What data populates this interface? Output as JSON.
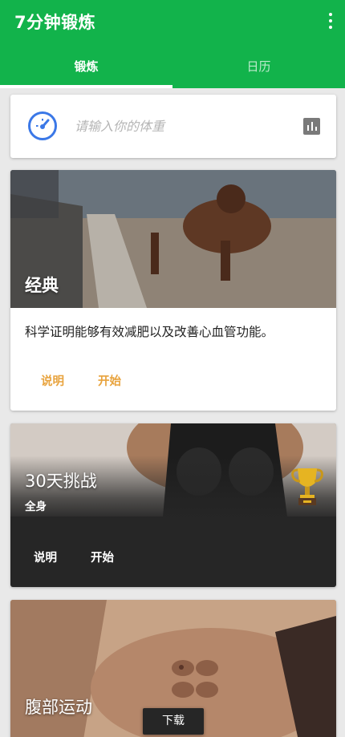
{
  "app": {
    "title": "7分钟锻炼"
  },
  "tabs": [
    {
      "label": "锻炼",
      "active": true
    },
    {
      "label": "日历",
      "active": false
    }
  ],
  "weight": {
    "placeholder": "请输入你的体重"
  },
  "cards": [
    {
      "title": "经典",
      "description": "科学证明能够有效减肥以及改善心血管功能。",
      "info_label": "说明",
      "start_label": "开始"
    },
    {
      "title": "30天挑战",
      "subtitle": "全身",
      "info_label": "说明",
      "start_label": "开始"
    },
    {
      "title": "腹部运动"
    }
  ],
  "download_label": "下载",
  "colors": {
    "appbar": "#12b34b",
    "accent": "#e8a33d",
    "dark_card": "#262626"
  },
  "icons": [
    "more-vert-icon",
    "gauge-icon",
    "bar-chart-icon",
    "trophy-icon"
  ]
}
